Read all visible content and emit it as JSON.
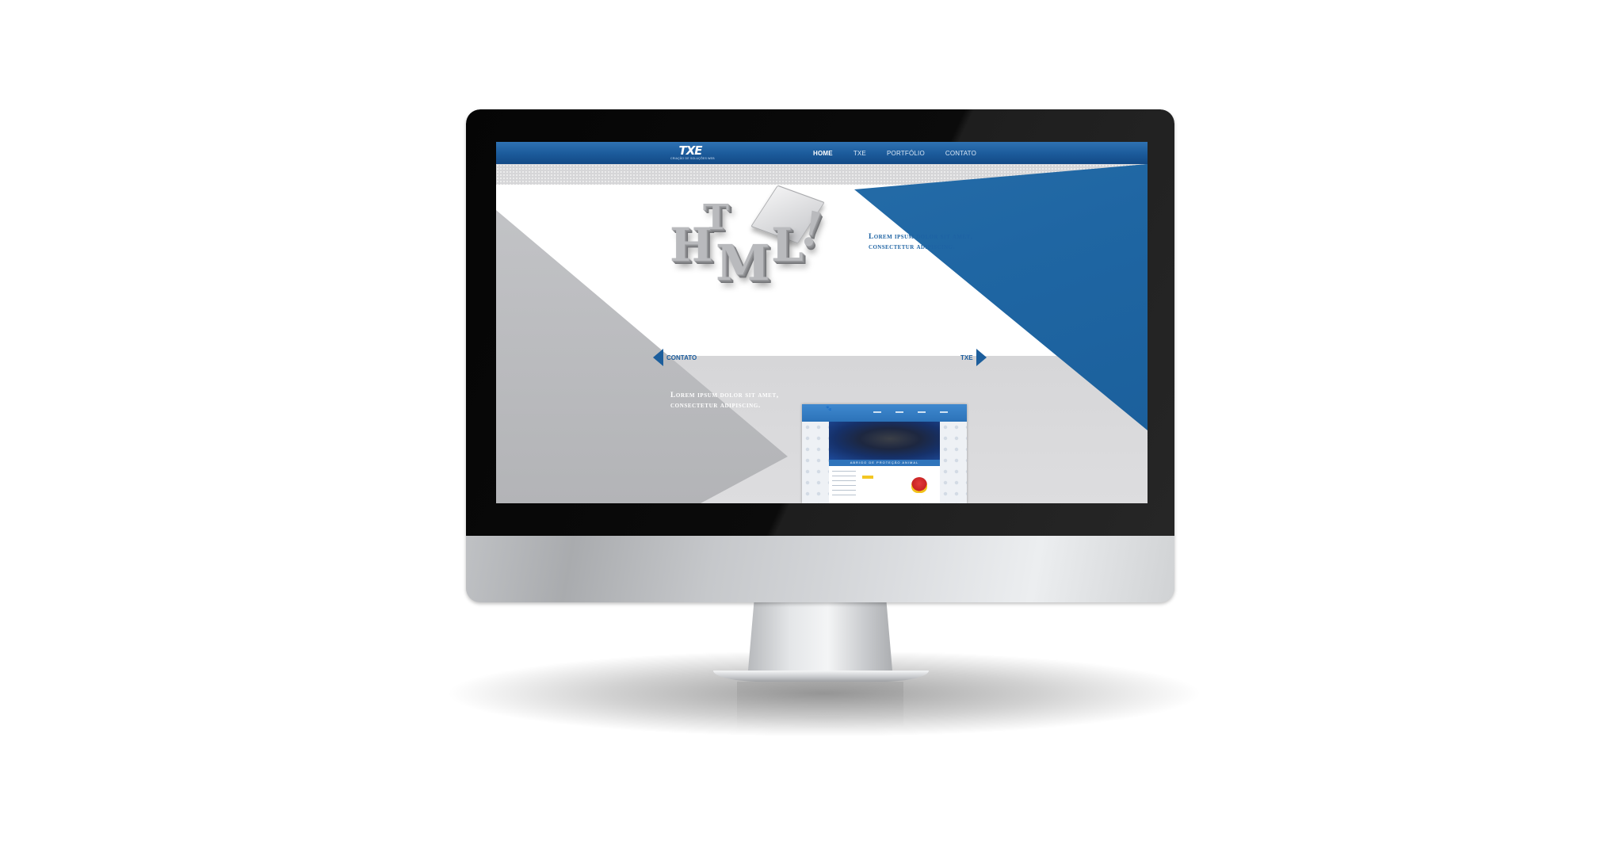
{
  "site": {
    "logo": {
      "word": "TXE",
      "tagline": "CRIAÇÃO DE SOLUÇÕES WEB"
    },
    "nav": [
      "HOME",
      "TXE",
      "PORTFÓLIO",
      "CONTATO"
    ],
    "active_nav": "HOME",
    "hero_text": [
      "Lorem ipsum dolor sit amet,",
      "consectetur adipiscing."
    ],
    "hero_art_letters": [
      "H",
      "T",
      "M",
      "L",
      "!"
    ],
    "arrow_prev_label": "CONTATO",
    "arrow_next_label": "TXE",
    "lower_text": [
      "Lorem ipsum dolor sit amet,",
      "consectetur adipiscing."
    ],
    "portfolio_thumb": {
      "caption": "ABRIGO DE PROTEÇÃO ANIMAL"
    }
  },
  "colors": {
    "brand_blue": "#1f66a3",
    "nav_bar": "#1b5a9a",
    "panel_grey": "#b7b8bb",
    "background_grey": "#dcdcde"
  },
  "icons": {
    "prev": "triangle-left-icon",
    "next": "triangle-right-icon"
  }
}
